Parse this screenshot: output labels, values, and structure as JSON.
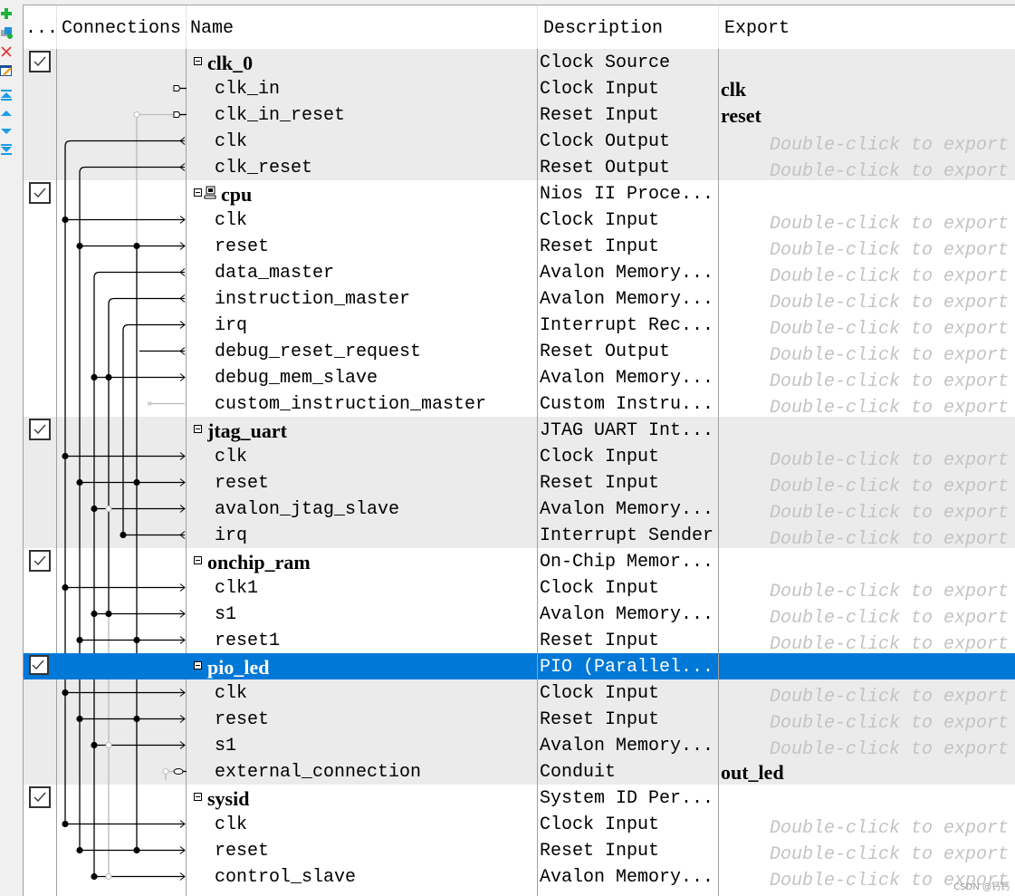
{
  "toolbar": {
    "icons": [
      "add-icon",
      "add-component-icon",
      "remove-icon",
      "edit-icon",
      "move-to-top-icon",
      "move-up-icon",
      "move-down-icon",
      "move-to-bottom-icon"
    ]
  },
  "header": {
    "use": "...",
    "connections": "Connections",
    "name": "Name",
    "description": "Description",
    "export": "Export"
  },
  "colors": {
    "selection": "#0078d7",
    "row_alt": "#ebebeb",
    "placeholder": "#c3c3c3"
  },
  "placeholder": "Double-click to export",
  "components": [
    {
      "name": "clk_0",
      "description": "Clock Source",
      "checked": true,
      "selected": false,
      "processor_icon": false,
      "ports": [
        {
          "name": "clk_in",
          "description": "Clock Input",
          "export": "clk"
        },
        {
          "name": "clk_in_reset",
          "description": "Reset Input",
          "export": "reset"
        },
        {
          "name": "clk",
          "description": "Clock Output",
          "export": ""
        },
        {
          "name": "clk_reset",
          "description": "Reset Output",
          "export": ""
        }
      ]
    },
    {
      "name": "cpu",
      "description": "Nios II Proce...",
      "checked": true,
      "selected": false,
      "processor_icon": true,
      "ports": [
        {
          "name": "clk",
          "description": "Clock Input",
          "export": ""
        },
        {
          "name": "reset",
          "description": "Reset Input",
          "export": ""
        },
        {
          "name": "data_master",
          "description": "Avalon Memory...",
          "export": ""
        },
        {
          "name": "instruction_master",
          "description": "Avalon Memory...",
          "export": ""
        },
        {
          "name": "irq",
          "description": "Interrupt Rec...",
          "export": ""
        },
        {
          "name": "debug_reset_request",
          "description": "Reset Output",
          "export": ""
        },
        {
          "name": "debug_mem_slave",
          "description": "Avalon Memory...",
          "export": ""
        },
        {
          "name": "custom_instruction_master",
          "description": "Custom Instru...",
          "export": ""
        }
      ]
    },
    {
      "name": "jtag_uart",
      "description": "JTAG UART Int...",
      "checked": true,
      "selected": false,
      "processor_icon": false,
      "ports": [
        {
          "name": "clk",
          "description": "Clock Input",
          "export": ""
        },
        {
          "name": "reset",
          "description": "Reset Input",
          "export": ""
        },
        {
          "name": "avalon_jtag_slave",
          "description": "Avalon Memory...",
          "export": ""
        },
        {
          "name": "irq",
          "description": "Interrupt Sender",
          "export": ""
        }
      ]
    },
    {
      "name": "onchip_ram",
      "description": "On-Chip Memor...",
      "checked": true,
      "selected": false,
      "processor_icon": false,
      "ports": [
        {
          "name": "clk1",
          "description": "Clock Input",
          "export": ""
        },
        {
          "name": "s1",
          "description": "Avalon Memory...",
          "export": ""
        },
        {
          "name": "reset1",
          "description": "Reset Input",
          "export": ""
        }
      ]
    },
    {
      "name": "pio_led",
      "description": "PIO (Parallel...",
      "checked": true,
      "selected": true,
      "processor_icon": false,
      "ports": [
        {
          "name": "clk",
          "description": "Clock Input",
          "export": ""
        },
        {
          "name": "reset",
          "description": "Reset Input",
          "export": ""
        },
        {
          "name": "s1",
          "description": "Avalon Memory...",
          "export": ""
        },
        {
          "name": "external_connection",
          "description": "Conduit",
          "export": "out_led"
        }
      ]
    },
    {
      "name": "sysid",
      "description": "System ID Per...",
      "checked": true,
      "selected": false,
      "processor_icon": false,
      "ports": [
        {
          "name": "clk",
          "description": "Clock Input",
          "export": ""
        },
        {
          "name": "reset",
          "description": "Reset Input",
          "export": ""
        },
        {
          "name": "control_slave",
          "description": "Avalon Memory...",
          "export": ""
        }
      ]
    }
  ],
  "watermark": "CSDN @钙钙"
}
